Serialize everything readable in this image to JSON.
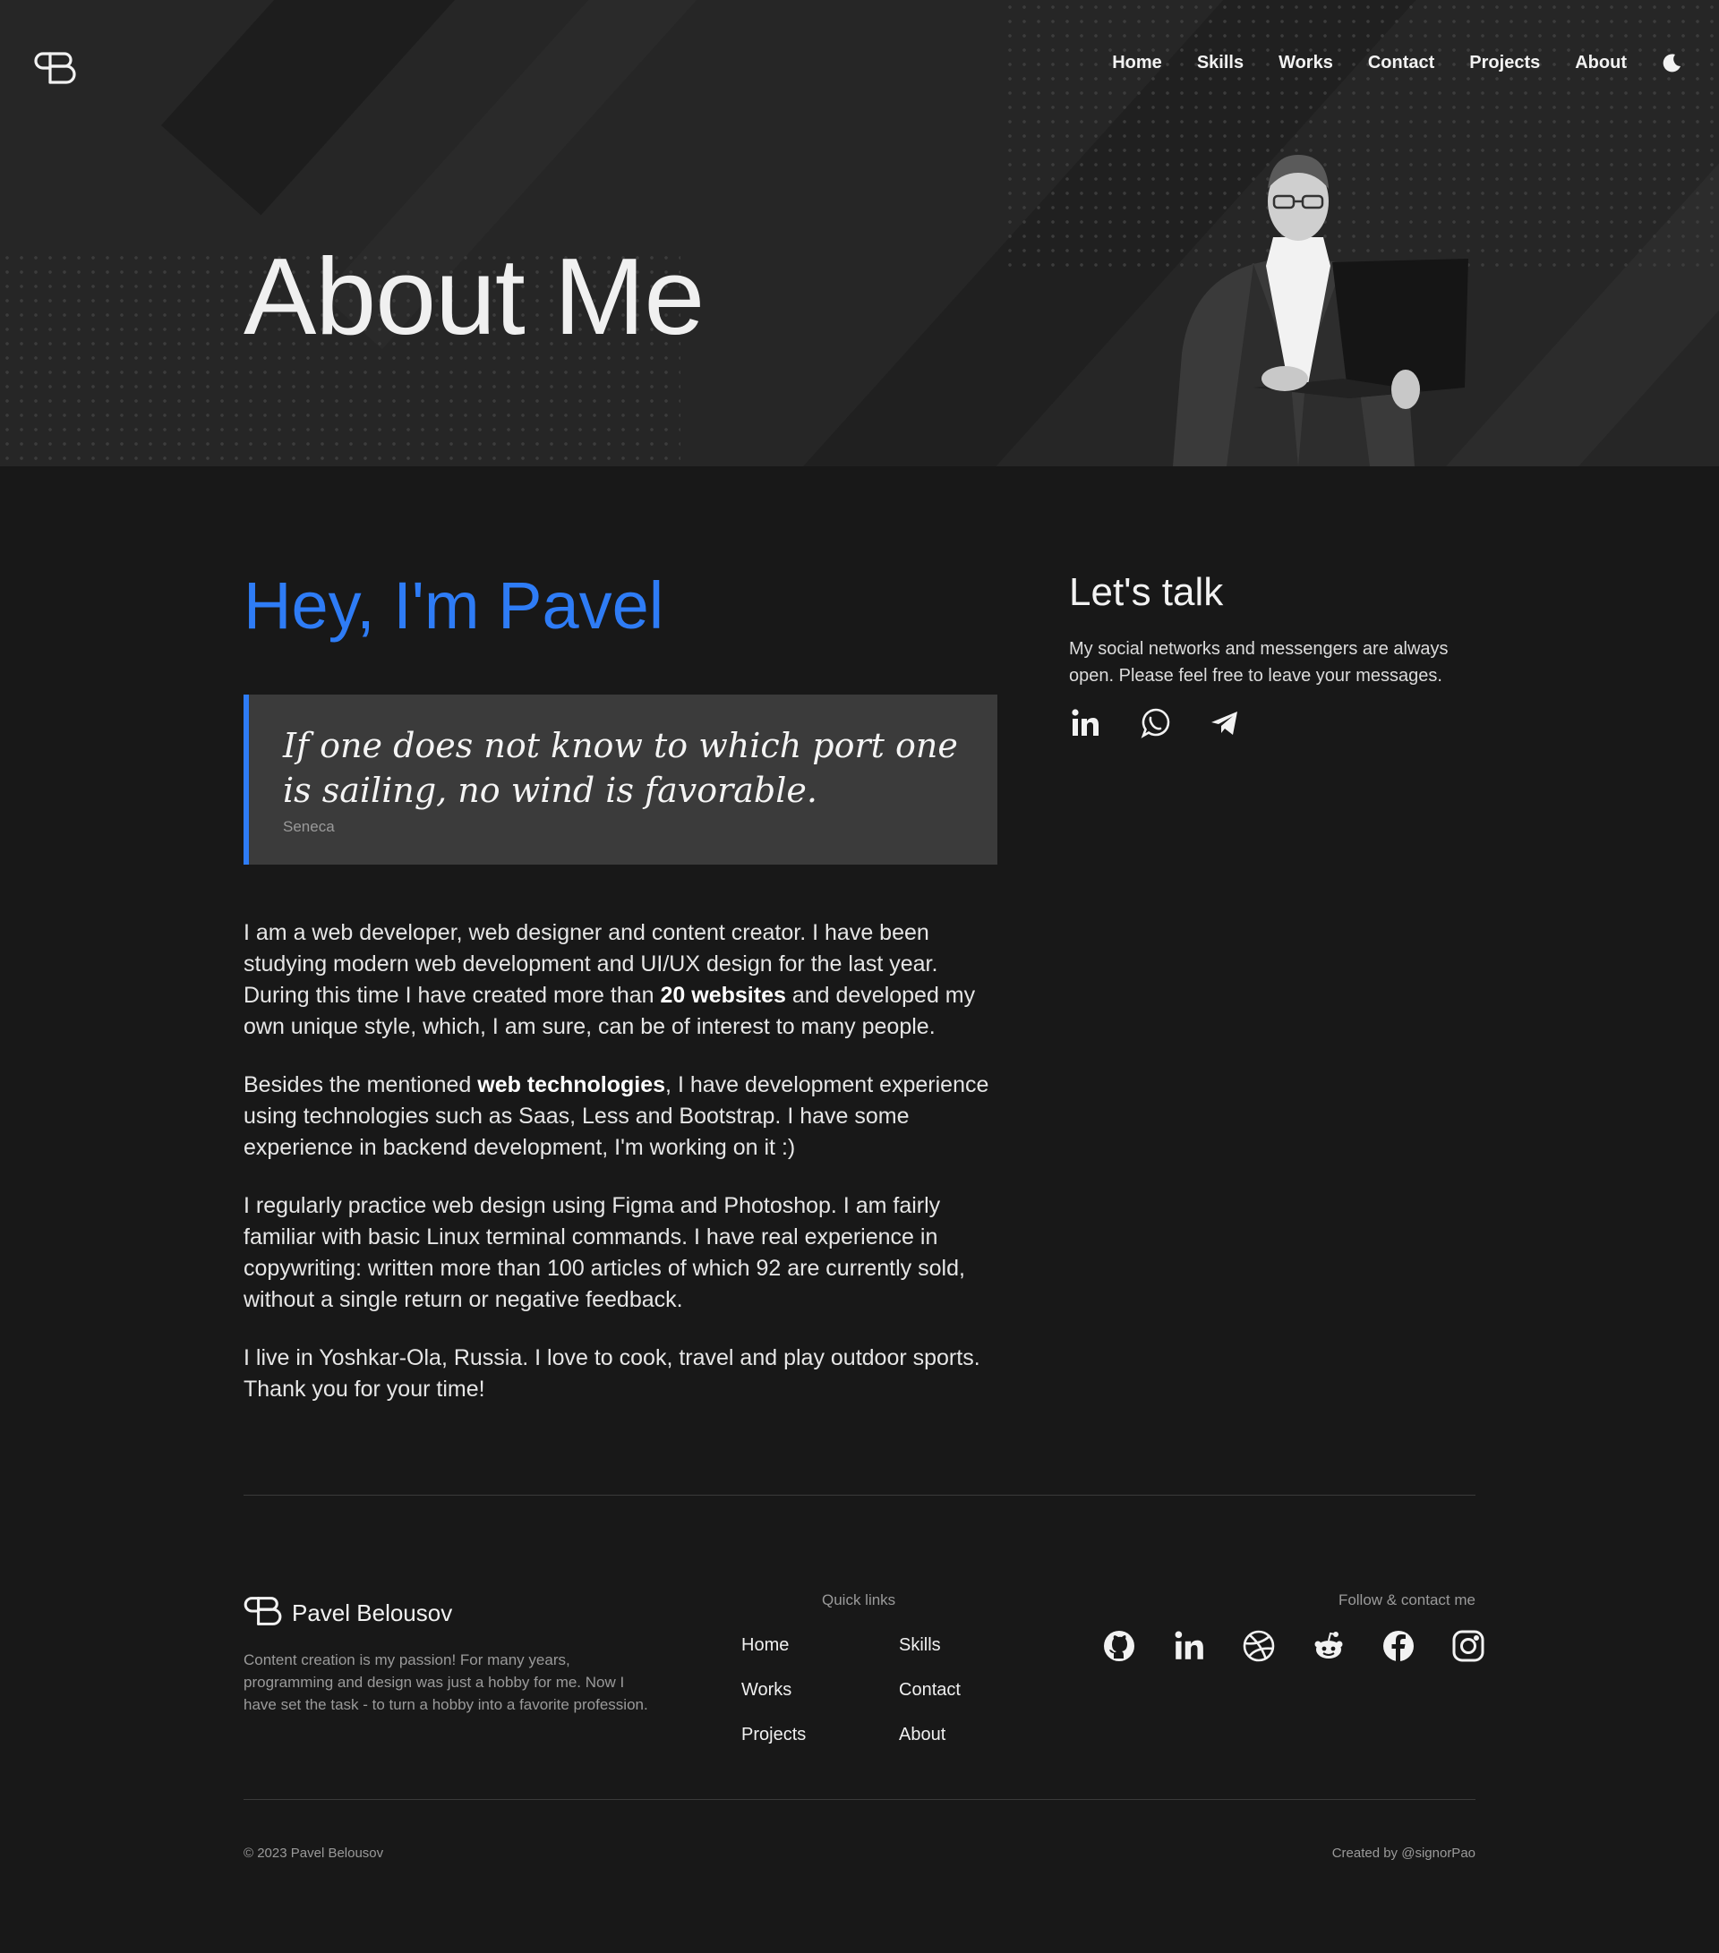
{
  "header": {
    "logo_icon": "pb-monogram-icon",
    "nav": [
      {
        "label": "Home"
      },
      {
        "label": "Skills"
      },
      {
        "label": "Works"
      },
      {
        "label": "Contact"
      },
      {
        "label": "Projects"
      },
      {
        "label": "About"
      }
    ],
    "theme_toggle_icon": "moon-icon"
  },
  "hero": {
    "title": "About Me",
    "image": "portrait-photo"
  },
  "main": {
    "greeting": "Hey, I'm Pavel",
    "quote": {
      "text": "If one does not know to which port one is sailing, no wind is favorable.",
      "author": "Seneca"
    },
    "bio": {
      "p1_a": "I am a web developer, web designer and content creator. I have been studying modern web development and UI/UX design for the last year. During this time I have created more than ",
      "p1_bold": "20 websites",
      "p1_b": " and developed my own unique style, which, I am sure, can be of interest to many people.",
      "p2_a": "Besides the mentioned ",
      "p2_bold": "web technologies",
      "p2_b": ", I have development experience using technologies such as Saas, Less and Bootstrap. I have some experience in backend development, I'm working on it :)",
      "p3": "I regularly practice web design using Figma and Photoshop. I am fairly familiar with basic Linux terminal commands. I have real experience in copywriting: written more than 100 articles of which 92 are currently sold, without a single return or negative feedback.",
      "p4": "I live in Yoshkar-Ola, Russia. I love to cook, travel and play outdoor sports. Thank you for your time!"
    }
  },
  "talk": {
    "title": "Let's talk",
    "text": "My social networks and messengers are always open. Please feel free to leave your messages.",
    "icons": [
      "linkedin-icon",
      "whatsapp-icon",
      "telegram-icon"
    ]
  },
  "footer": {
    "brand_name": "Pavel Belousov",
    "description": "Content creation is my passion! For many years, programming and design was just a hobby for me. Now I have set the task - to turn a hobby into a favorite profession.",
    "quick_links_title": "Quick links",
    "links": [
      {
        "label": "Home"
      },
      {
        "label": "Skills"
      },
      {
        "label": "Works"
      },
      {
        "label": "Contact"
      },
      {
        "label": "Projects"
      },
      {
        "label": "About"
      }
    ],
    "follow_title": "Follow & contact me",
    "social_icons": [
      "github-icon",
      "linkedin-icon",
      "dribbble-icon",
      "reddit-icon",
      "facebook-icon",
      "instagram-icon"
    ],
    "copyright": "© 2023 Pavel Belousov",
    "credit": "Created by @signorPao"
  },
  "colors": {
    "accent": "#2e7cf6",
    "background": "#181818",
    "hero_background": "#262626",
    "quote_background": "#3b3b3b"
  }
}
